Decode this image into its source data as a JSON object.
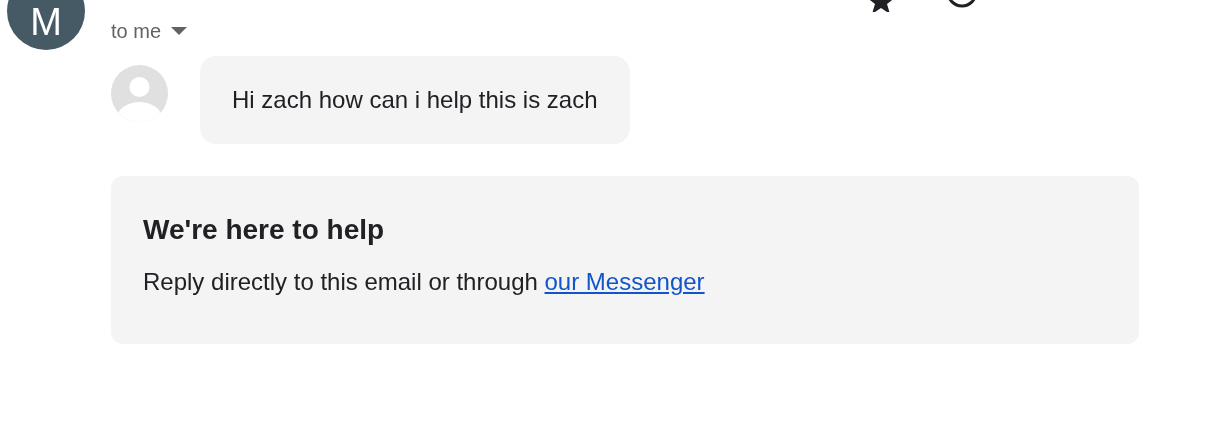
{
  "sender": {
    "avatar_letter": "M"
  },
  "recipient": {
    "label": "to me"
  },
  "message": {
    "text": "Hi zach how can i help this is zach"
  },
  "help_card": {
    "title": "We're here to help",
    "text": "Reply directly to this email or through ",
    "link": "our Messenger"
  }
}
